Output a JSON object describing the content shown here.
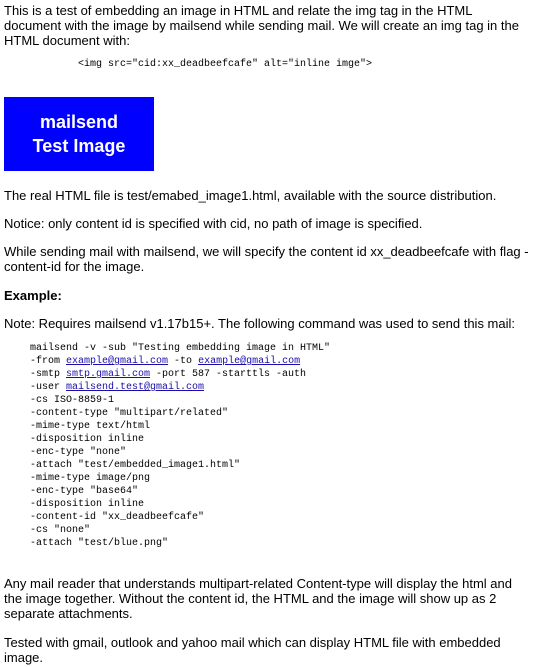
{
  "intro": "This is a test of embedding an image in HTML and relate the img tag in the HTML document with the image by mailsend while sending mail. We will create an img tag in the HTML document with:",
  "img_tag_code": "<img src=\"cid:xx_deadbeefcafe\" alt=\"inline imge\">",
  "image": {
    "line1": "mailsend",
    "line2": "Test Image",
    "color": "#0000ff"
  },
  "para_real_file": "The real HTML file is test/emabed_image1.html, available with the source distribution.",
  "para_notice": "Notice: only content id is specified with cid, no path of image is specified.",
  "para_while": "While sending mail with mailsend, we will specify the content id xx_deadbeefcafe with flag -content-id for the image.",
  "example_heading": "Example:",
  "para_note": "Note: Requires mailsend v1.17b15+. The following command was used to send this mail:",
  "command": {
    "l1": "mailsend -v -sub \"Testing embedding image in HTML\"",
    "l2_a": "-from ",
    "l2_link1": "example@gmail.com",
    "l2_b": " -to ",
    "l2_link2": "example@gmail.com",
    "l3_a": "-smtp ",
    "l3_link": "smtp.gmail.com",
    "l3_b": " -port 587 -starttls -auth",
    "l4_a": "-user ",
    "l4_link": "mailsend.test@gmail.com",
    "rest": [
      "-cs ISO-8859-1",
      "-content-type \"multipart/related\"",
      "-mime-type text/html",
      "-disposition inline",
      "-enc-type \"none\"",
      "-attach \"test/embedded_image1.html\"",
      "-mime-type image/png",
      "-enc-type \"base64\"",
      "-disposition inline",
      "-content-id \"xx_deadbeefcafe\"",
      "-cs \"none\"",
      "-attach \"test/blue.png\""
    ]
  },
  "para_any": "Any mail reader that understands multipart-related Content-type will display the html and the image together. Without the content id, the HTML and the image will show up as 2 separate attachments.",
  "para_tested": "Tested with gmail, outlook and yahoo mail which can display HTML file with embedded image."
}
